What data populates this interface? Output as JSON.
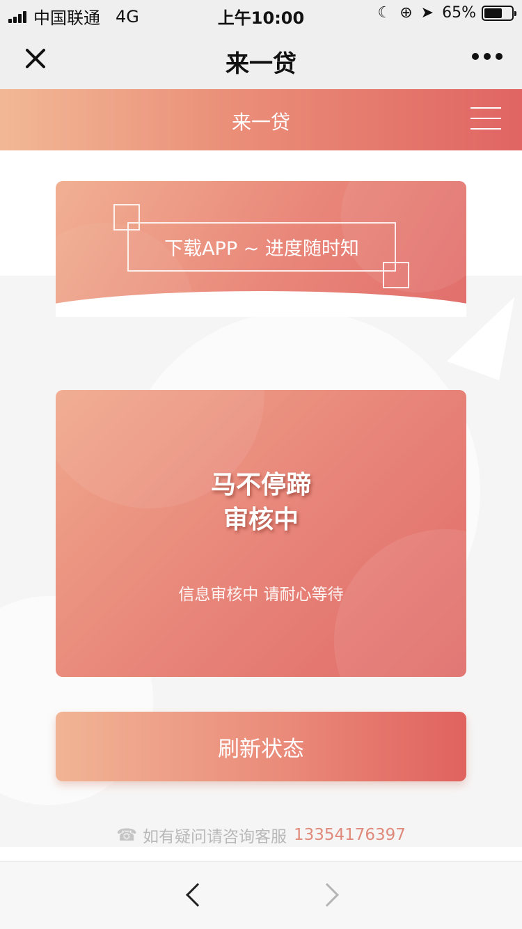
{
  "status_bar": {
    "carrier": "中国联通",
    "network": "4G",
    "time": "上午10:00",
    "battery_text": "65%",
    "battery_level": 0.65,
    "icons": [
      "signal-icon",
      "moon-icon",
      "rotation-lock-icon",
      "location-arrow-icon",
      "battery-icon"
    ]
  },
  "nav": {
    "title": "来一贷"
  },
  "header": {
    "title": "来一贷"
  },
  "download_banner": {
    "text": "下载APP ~ 进度随时知"
  },
  "status_card": {
    "line1": "马不停蹄",
    "line2": "审核中",
    "subtitle": "信息审核中 请耐心等待"
  },
  "refresh": {
    "label": "刷新状态"
  },
  "contact": {
    "text": "如有疑问请咨询客服",
    "phone": "13354176397"
  },
  "colors": {
    "accent_start": "#f1b495",
    "accent_end": "#e0625f",
    "phone": "#e08a7c"
  }
}
